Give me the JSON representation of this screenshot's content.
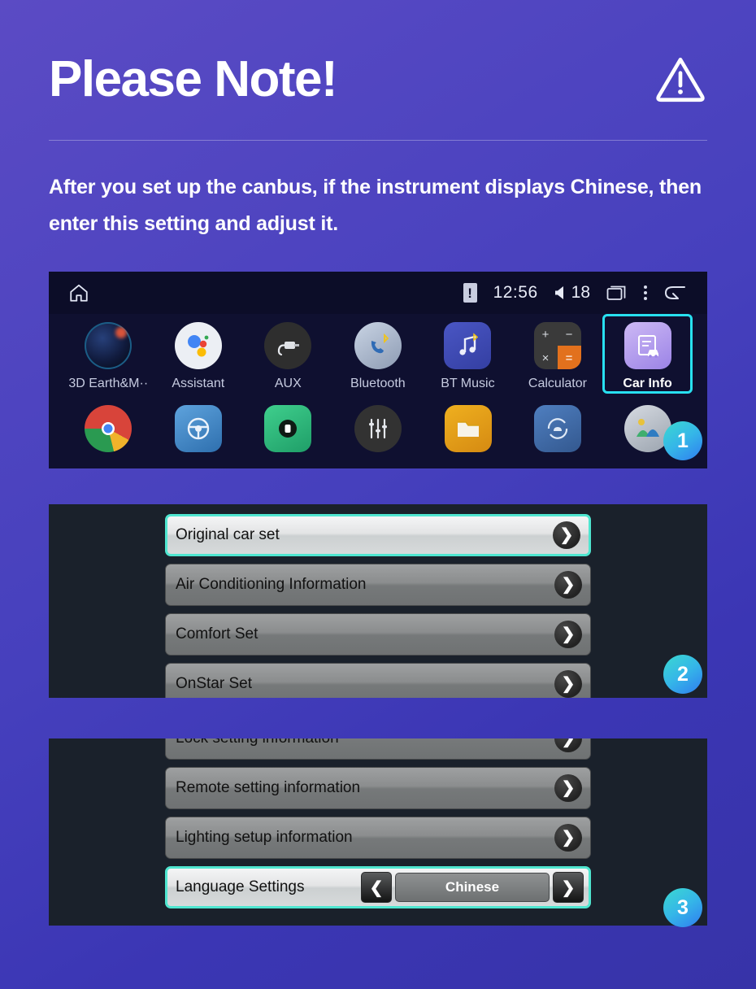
{
  "header": {
    "title": "Please Note!",
    "warning_icon": "warning-triangle-icon"
  },
  "intro": {
    "text": "After you set up the canbus, if the instrument displays Chinese, then enter this setting and adjust it."
  },
  "head_unit": {
    "statusbar": {
      "home_icon": "home-icon",
      "warning_icon": "warning-badge-icon",
      "time": "12:56",
      "volume_icon": "volume-icon",
      "volume_level": "18",
      "recents_icon": "recents-icon",
      "overflow_icon": "overflow-menu-icon",
      "back_icon": "back-arrow-icon"
    },
    "apps_row1": [
      {
        "label": "3D Earth&M··",
        "icon": "earth-icon",
        "selected": false
      },
      {
        "label": "Assistant",
        "icon": "assistant-icon",
        "selected": false
      },
      {
        "label": "AUX",
        "icon": "aux-icon",
        "selected": false
      },
      {
        "label": "Bluetooth",
        "icon": "bluetooth-phone-icon",
        "selected": false
      },
      {
        "label": "BT Music",
        "icon": "bt-music-icon",
        "selected": false
      },
      {
        "label": "Calculator",
        "icon": "calculator-icon",
        "selected": false
      },
      {
        "label": "Car Info",
        "icon": "car-info-icon",
        "selected": true
      }
    ],
    "apps_row2": [
      {
        "label": "",
        "icon": "chrome-icon"
      },
      {
        "label": "",
        "icon": "steering-wheel-icon"
      },
      {
        "label": "",
        "icon": "recorder-icon"
      },
      {
        "label": "",
        "icon": "equalizer-icon"
      },
      {
        "label": "",
        "icon": "folder-icon"
      },
      {
        "label": "",
        "icon": "cloud-sync-icon"
      },
      {
        "label": "",
        "icon": "gallery-icon"
      }
    ]
  },
  "car_info_list_1": {
    "rows": [
      {
        "label": "Original car set",
        "highlight": true
      },
      {
        "label": "Air Conditioning Information",
        "highlight": false
      },
      {
        "label": "Comfort Set",
        "highlight": false
      },
      {
        "label": "OnStar Set",
        "highlight": false
      }
    ]
  },
  "car_info_list_2": {
    "rows": [
      {
        "label": "Lock setting information",
        "highlight": false
      },
      {
        "label": "Remote setting information",
        "highlight": false
      },
      {
        "label": "Lighting setup information",
        "highlight": false
      }
    ],
    "language_row": {
      "label": "Language Settings",
      "prev_icon": "chevron-left-icon",
      "value": "Chinese",
      "next_icon": "chevron-right-icon",
      "highlight": true
    }
  },
  "badges": {
    "one": "1",
    "two": "2",
    "three": "3"
  },
  "colors": {
    "accent_cyan": "#28e0f0",
    "highlight_border": "#4fe6d0",
    "badge_gradient_start": "#3bd9d0",
    "badge_gradient_end": "#2f7cf0",
    "bg_purple": "#5b4bc4",
    "panel_dark": "#1a212b"
  }
}
